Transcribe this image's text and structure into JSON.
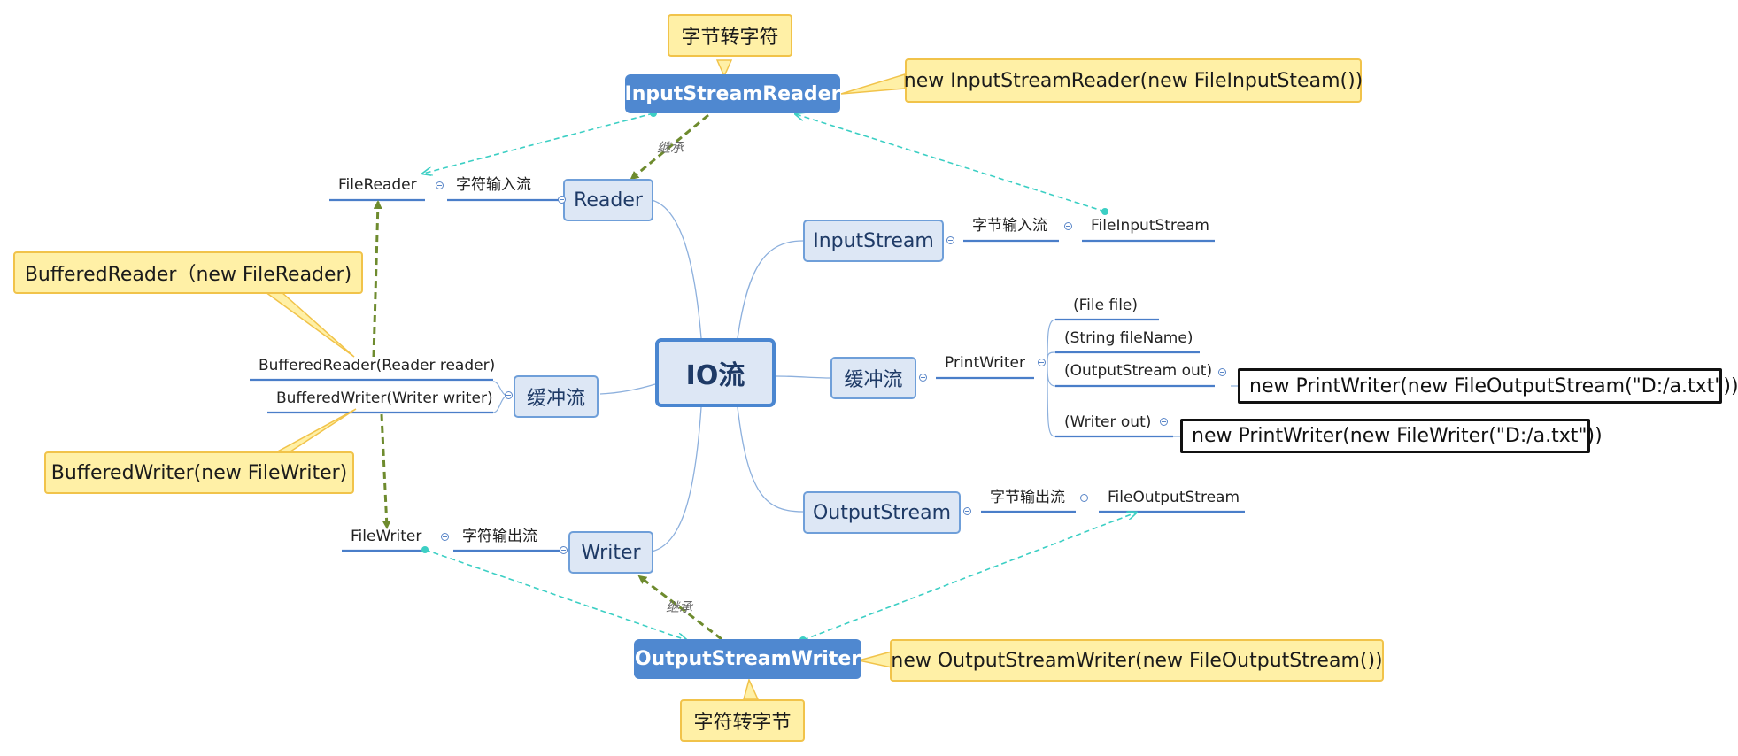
{
  "central": "IO流",
  "left": {
    "reader": {
      "label": "Reader",
      "category": "字符输入流",
      "leaf": "FileReader"
    },
    "buffer": {
      "label": "缓冲流",
      "leaves": [
        "BufferedReader(Reader reader)",
        "BufferedWriter(Writer writer)"
      ]
    },
    "writer": {
      "label": "Writer",
      "category": "字符输出流",
      "leaf": "FileWriter"
    }
  },
  "right": {
    "input_stream": {
      "label": "InputStream",
      "category": "字节输入流",
      "leaf": "FileInputStream"
    },
    "buffer": {
      "label": "缓冲流",
      "print_writer": "PrintWriter",
      "constructors": [
        "(File file)",
        "(String fileName)",
        "(OutputStream out)",
        "(Writer out)"
      ]
    },
    "output_stream": {
      "label": "OutputStream",
      "category": "字节输出流",
      "leaf": "FileOutputStream"
    }
  },
  "floating": {
    "input_stream_reader": "InputStreamReader",
    "output_stream_writer": "OutputStreamWriter"
  },
  "relationships": {
    "inherit_top": "继承",
    "inherit_bottom": "继承"
  },
  "notes": {
    "isr_title": "字节转字符",
    "isr_example": "new InputStreamReader(new FileInputSteam())",
    "osw_title": "字符转字节",
    "osw_example": "new OutputStreamWriter(new FileOutputStream())",
    "buffered_reader": "BufferedReader（new FileReader)",
    "buffered_writer": "BufferedWriter(new FileWriter)"
  },
  "callouts": {
    "pw_stream": "new PrintWriter(new FileOutputStream(\"D:/a.txt\"))",
    "pw_writer": "new PrintWriter(new FileWriter(\"D:/a.txt\"))"
  },
  "colors": {
    "topic_border": "#6f9fd9",
    "topic_fill": "#dde7f5",
    "floating_fill": "#4f88d0",
    "note_fill": "#fff0a6",
    "note_border": "#f1c34a",
    "inherit_arrow": "#6e8b2e",
    "link_arrow": "#3ccfc4"
  }
}
